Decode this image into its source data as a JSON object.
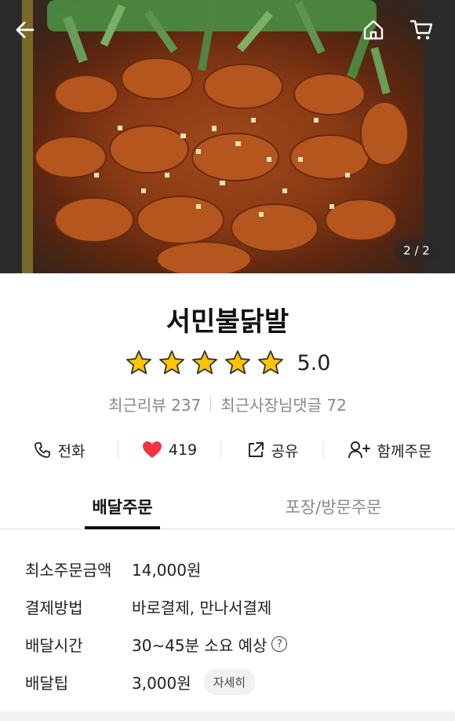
{
  "hero": {
    "page_indicator": "2 / 2",
    "image_icon": "food-photo-spicy-chicken-feet"
  },
  "nav": {
    "back_icon": "arrow-left-icon",
    "home_icon": "home-icon",
    "cart_icon": "cart-icon"
  },
  "store": {
    "name": "서민불닭발",
    "rating": "5.0",
    "stars": 5,
    "reviews_label": "최근리뷰 237",
    "owner_replies_label": "최근사장님댓글 72"
  },
  "actions": {
    "call_label": "전화",
    "like_count": "419",
    "share_label": "공유",
    "group_order_label": "함께주문"
  },
  "tabs": {
    "delivery": "배달주문",
    "pickup": "포장/방문주문"
  },
  "details": {
    "min_order_label": "최소주문금액",
    "min_order_value": "14,000원",
    "payment_label": "결제방법",
    "payment_value": "바로결제, 만나서결제",
    "delivery_time_label": "배달시간",
    "delivery_time_value": "30~45분 소요 예상",
    "delivery_tip_label": "배달팁",
    "delivery_tip_value": "3,000원",
    "more_label": "자세히"
  },
  "colors": {
    "accent_text": "#111111",
    "muted_text": "#888888",
    "star": "#FFC400",
    "heart": "#F2323F"
  }
}
